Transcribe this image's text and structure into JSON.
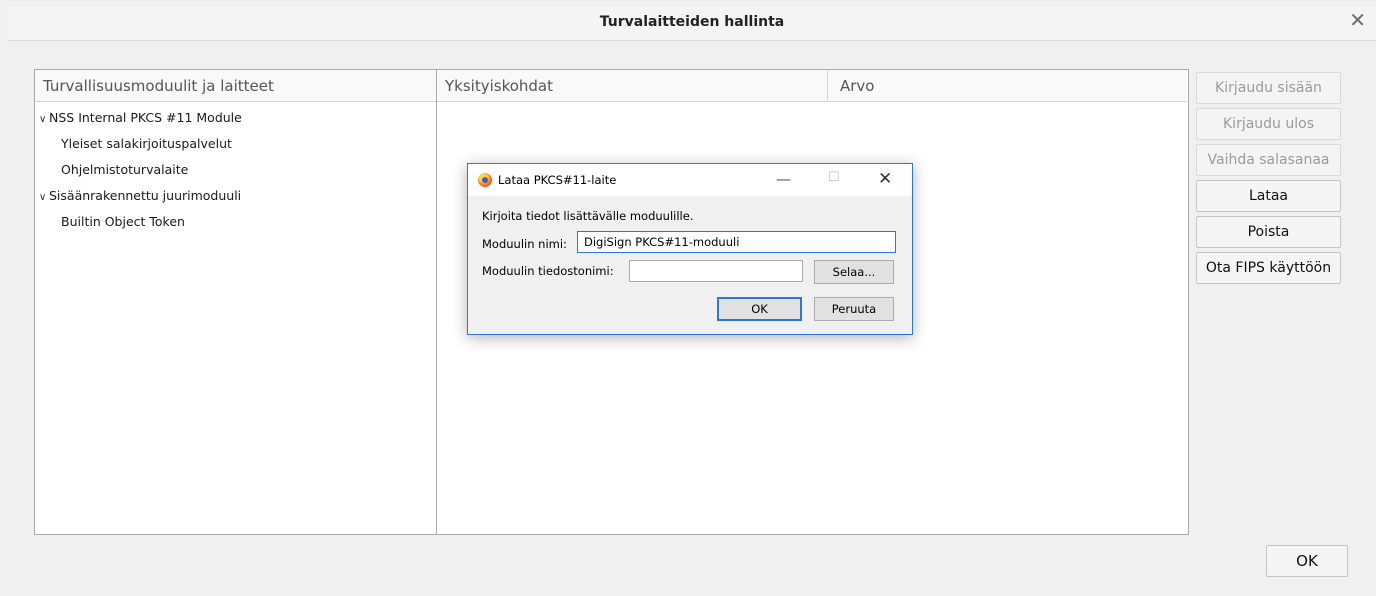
{
  "window": {
    "title": "Turvalaitteiden hallinta"
  },
  "tree": {
    "header": "Turvallisuusmoduulit ja laitteet",
    "items": [
      {
        "label": "NSS Internal PKCS #11 Module",
        "expanded": true
      },
      {
        "label": "Yleiset salakirjoituspalvelut"
      },
      {
        "label": "Ohjelmistoturvalaite"
      },
      {
        "label": "Sisäänrakennettu juurimoduuli",
        "expanded": true
      },
      {
        "label": "Builtin Object Token"
      }
    ]
  },
  "details": {
    "col_details": "Yksityiskohdat",
    "col_value": "Arvo"
  },
  "buttons": {
    "login": "Kirjaudu sisään",
    "logout": "Kirjaudu ulos",
    "change_password": "Vaihda salasanaa",
    "load": "Lataa",
    "remove": "Poista",
    "fips": "Ota FIPS käyttöön",
    "ok": "OK"
  },
  "dialog": {
    "title": "Lataa PKCS#11-laite",
    "description": "Kirjoita tiedot lisättävälle moduulille.",
    "name_label": "Moduulin nimi:",
    "name_value": "DigiSign PKCS#11-moduuli",
    "file_label": "Moduulin tiedostonimi:",
    "file_value": "",
    "browse": "Selaa...",
    "ok": "OK",
    "cancel": "Peruuta"
  },
  "icons": {
    "close": "close-icon",
    "twisty": "chevron-down-icon",
    "app": "firefox-icon",
    "minimize": "minimize-icon",
    "maximize": "maximize-icon"
  },
  "colors": {
    "accent": "#2b79d6",
    "disabled_text": "#9b9b9b"
  }
}
